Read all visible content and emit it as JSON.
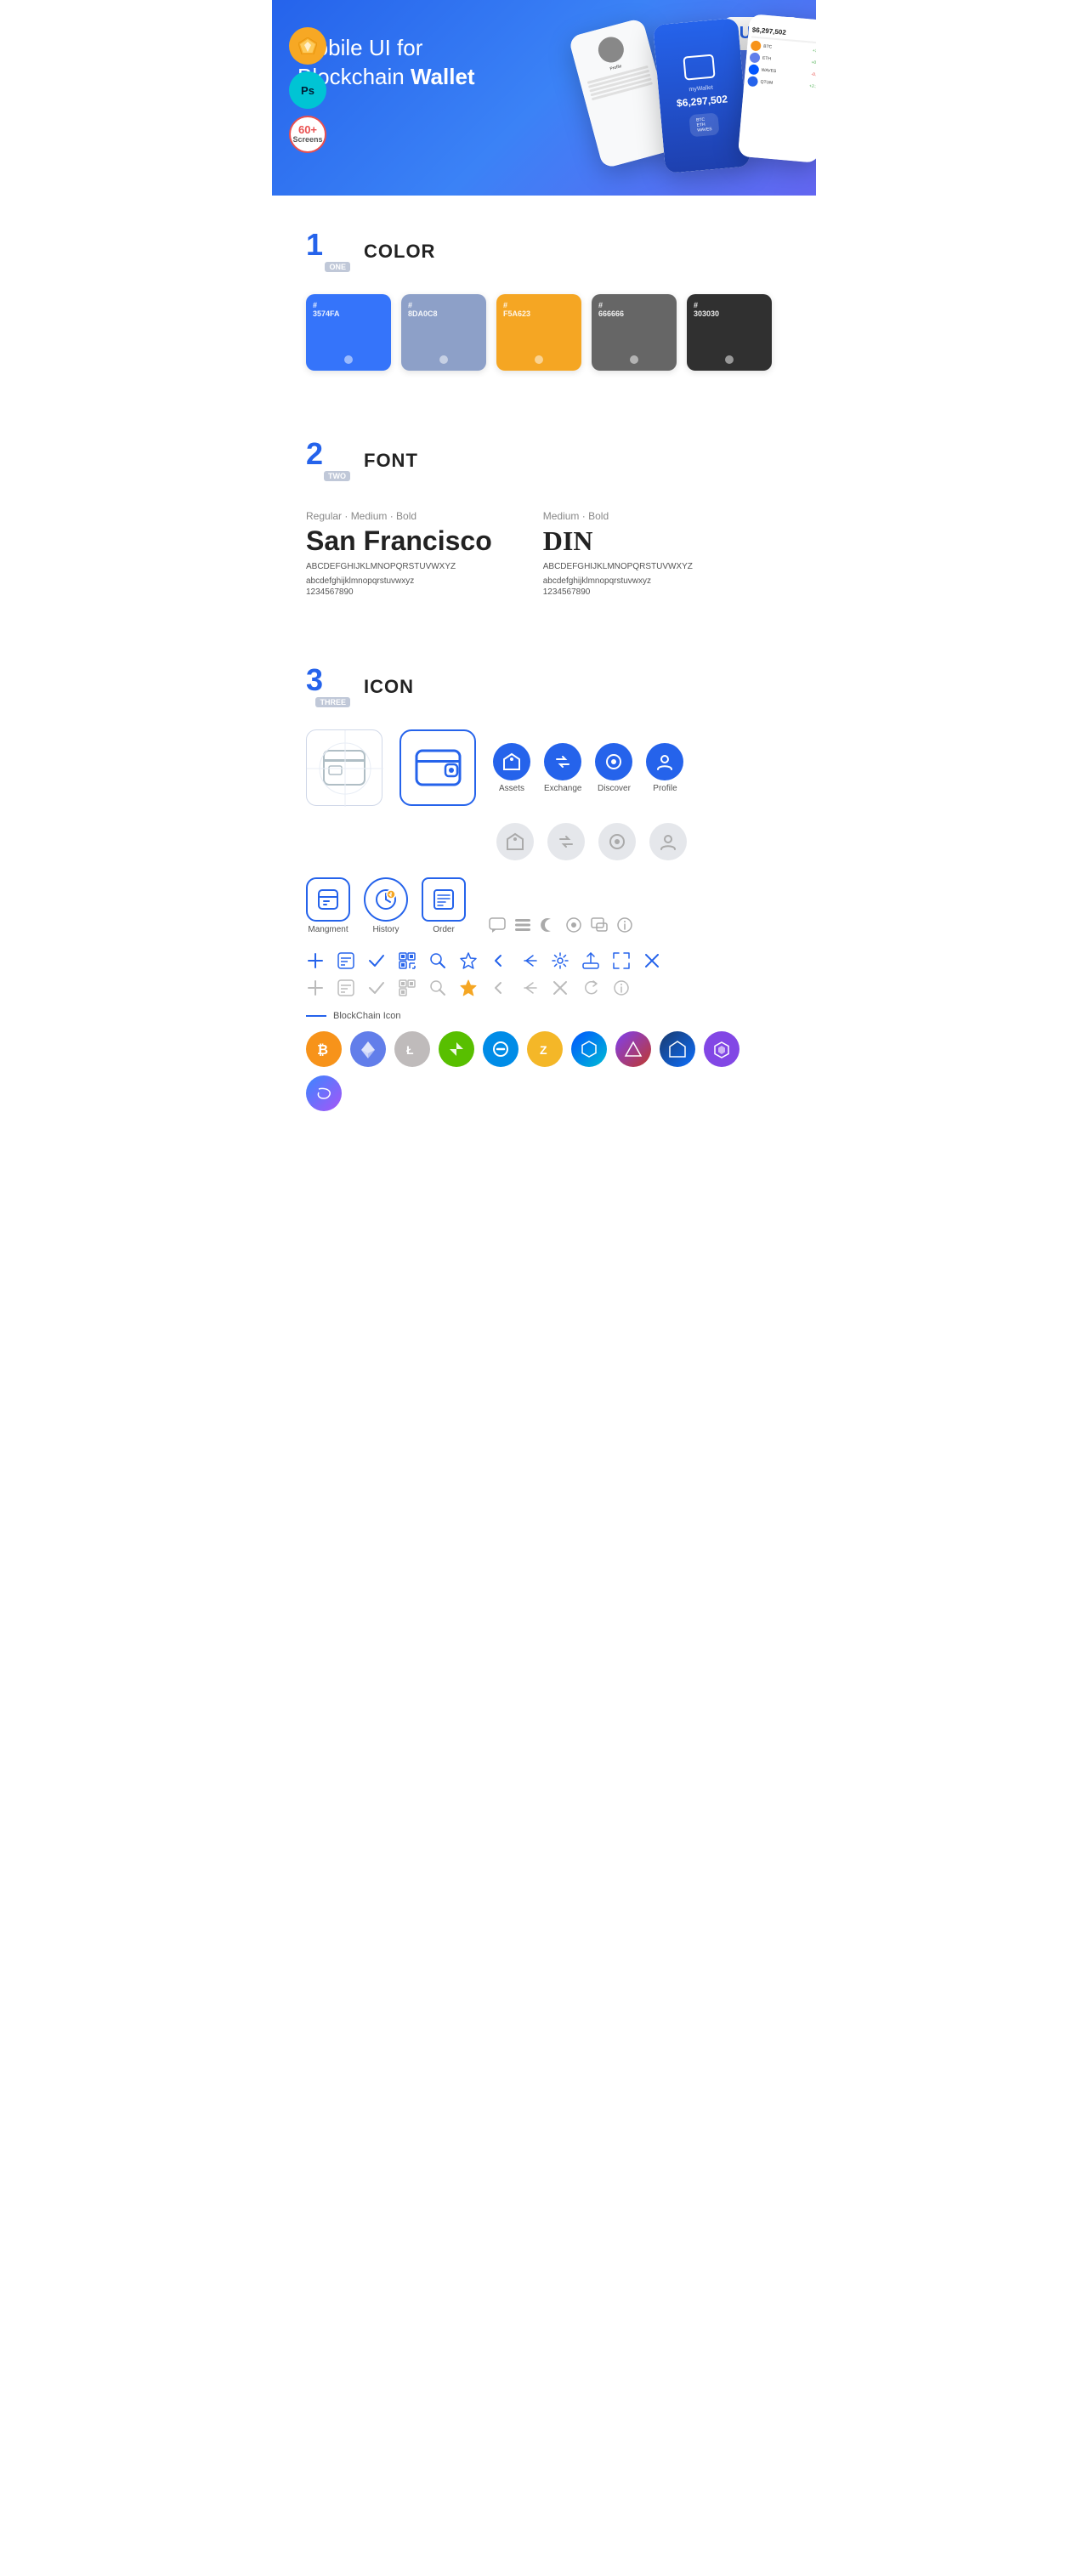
{
  "hero": {
    "title_normal": "Mobile UI for Blockchain ",
    "title_bold": "Wallet",
    "badge": "UI Kit",
    "sketch_label": "Sk",
    "ps_label": "Ps",
    "screens_count": "60+",
    "screens_label": "Screens"
  },
  "sections": {
    "color": {
      "number": "1",
      "word": "ONE",
      "title": "COLOR",
      "swatches": [
        {
          "hex": "#3574FA",
          "label": "#3574FA",
          "dot": true
        },
        {
          "hex": "#8DA0C8",
          "label": "#8DA0C8",
          "dot": true
        },
        {
          "hex": "#F5A623",
          "label": "#F5A623",
          "dot": true
        },
        {
          "hex": "#666666",
          "label": "#666666",
          "dot": true
        },
        {
          "hex": "#303030",
          "label": "#303030",
          "dot": true
        }
      ]
    },
    "font": {
      "number": "2",
      "word": "TWO",
      "title": "FONT",
      "font1": {
        "meta": "Regular · Medium · Bold",
        "name": "San Francisco",
        "upper": "ABCDEFGHIJKLMNOPQRSTUVWXYZ",
        "lower": "abcdefghijklmnopqrstuvwxyz",
        "numbers": "1234567890"
      },
      "font2": {
        "meta": "Medium · Bold",
        "name": "DIN",
        "upper": "ABCDEFGHIJKLMNOPQRSTUVWXYZ",
        "lower": "abcdefghijklmnopqrstuvwxyz",
        "numbers": "1234567890"
      }
    },
    "icon": {
      "number": "3",
      "word": "THREE",
      "title": "ICON",
      "named_icons": [
        {
          "label": "Assets"
        },
        {
          "label": "Exchange"
        },
        {
          "label": "Discover"
        },
        {
          "label": "Profile"
        }
      ],
      "app_icons": [
        {
          "label": "Mangment"
        },
        {
          "label": "History"
        },
        {
          "label": "Order"
        }
      ],
      "blockchain_label": "BlockChain Icon",
      "coins": [
        {
          "symbol": "₿",
          "label": "Bitcoin",
          "class": "coin-btc"
        },
        {
          "symbol": "⬡",
          "label": "Ethereum",
          "class": "coin-eth"
        },
        {
          "symbol": "Ł",
          "label": "Litecoin",
          "class": "coin-ltc"
        },
        {
          "symbol": "N",
          "label": "NEO",
          "class": "coin-neo"
        },
        {
          "symbol": "◈",
          "label": "Dash",
          "class": "coin-dash"
        },
        {
          "symbol": "ℤ",
          "label": "Zcash",
          "class": "coin-zcash"
        },
        {
          "symbol": "⬡",
          "label": "Waves",
          "class": "coin-waves"
        },
        {
          "symbol": "△",
          "label": "Ark",
          "class": "coin-ark"
        },
        {
          "symbol": "◇",
          "label": "Lisk",
          "class": "coin-lisk"
        },
        {
          "symbol": "⬡",
          "label": "Matic",
          "class": "coin-matic"
        },
        {
          "symbol": "∞",
          "label": "Band",
          "class": "coin-band"
        }
      ]
    }
  }
}
